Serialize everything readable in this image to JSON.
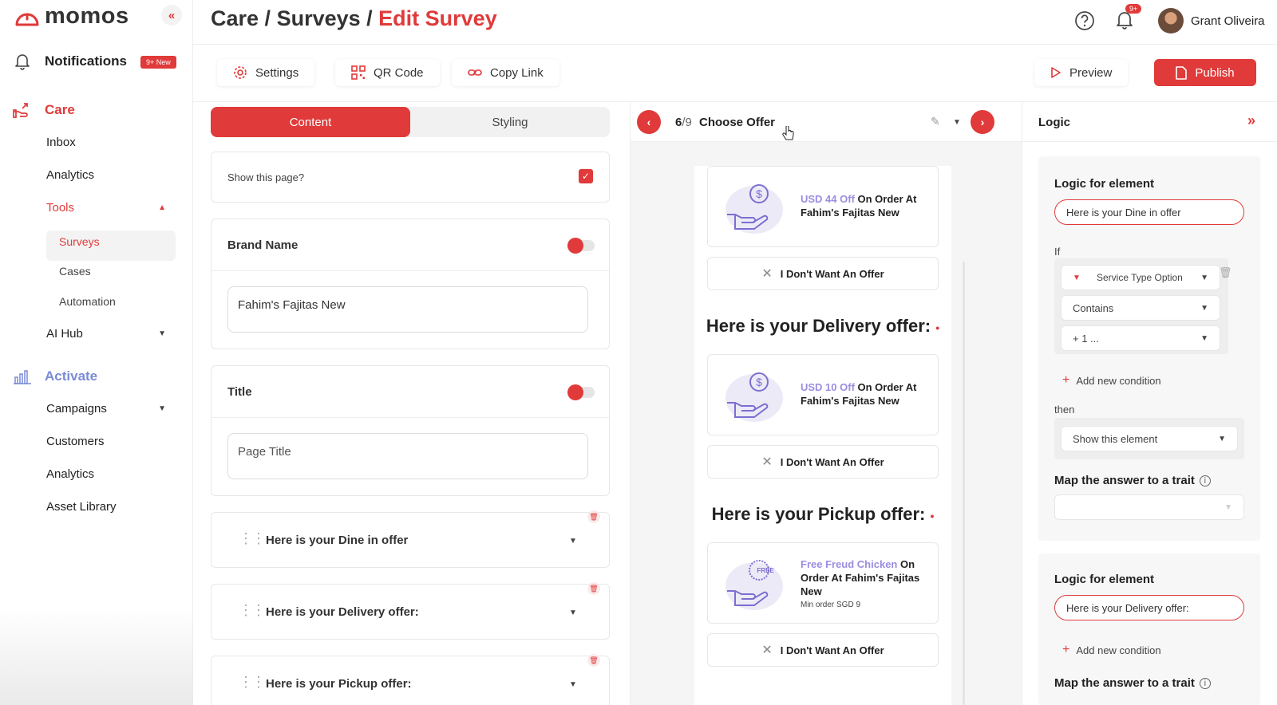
{
  "app": {
    "logo_text": "momos",
    "collapse_label": "«"
  },
  "sidebar": {
    "notifications": {
      "label": "Notifications",
      "badge": "9+ New"
    },
    "care": {
      "label": "Care",
      "items": {
        "inbox": "Inbox",
        "analytics": "Analytics",
        "tools": "Tools",
        "surveys": "Surveys",
        "cases": "Cases",
        "automation": "Automation",
        "ai_hub": "AI Hub"
      }
    },
    "activate": {
      "label": "Activate",
      "items": {
        "campaigns": "Campaigns",
        "customers": "Customers",
        "analytics": "Analytics",
        "asset_library": "Asset Library"
      }
    }
  },
  "header": {
    "breadcrumb": {
      "part1": "Care",
      "sep1": " / ",
      "part2": "Surveys",
      "sep2": " / ",
      "current": "Edit Survey"
    },
    "notif_count": "9+",
    "user_name": "Grant Oliveira"
  },
  "toolbar": {
    "settings": "Settings",
    "qr_code": "QR Code",
    "copy_link": "Copy Link",
    "preview": "Preview",
    "publish": "Publish"
  },
  "content_panel": {
    "tab_content": "Content",
    "tab_styling": "Styling",
    "show_page_label": "Show this page?",
    "brand_name_label": "Brand Name",
    "brand_name_value": "Fahim's Fajitas New",
    "title_label": "Title",
    "title_placeholder": "Page Title",
    "accordions": [
      "Here is your Dine in offer",
      "Here is your Delivery offer:",
      "Here is your Pickup offer:"
    ]
  },
  "preview": {
    "page_current": "6",
    "page_total": "/9",
    "page_name": "Choose Offer",
    "offers": [
      {
        "highlight": "USD 44 Off",
        "text": " On Order At Fahim's Fajitas New",
        "min_order": ""
      },
      {
        "highlight": "USD 10 Off",
        "text": " On Order At Fahim's Fajitas New",
        "min_order": ""
      },
      {
        "highlight": "Free Freud Chicken",
        "text": " On Order At Fahim's Fajitas New",
        "min_order": "Min order SGD 9"
      }
    ],
    "no_offer_label": "I Don't Want An Offer",
    "section_titles": [
      "Here is your Delivery offer:",
      "Here is your Pickup offer:"
    ],
    "free_badge": "FREE"
  },
  "logic_panel": {
    "title": "Logic",
    "blocks": [
      {
        "heading": "Logic for element",
        "element": "Here is your Dine in offer",
        "if_label": "If",
        "condition_field": "Service Type Option",
        "operator": "Contains",
        "value": "+ 1 ...",
        "add_condition": "Add new condition",
        "then_label": "then",
        "action": "Show this element",
        "map_trait_label": "Map the answer to a trait"
      },
      {
        "heading": "Logic for element",
        "element": "Here is your Delivery offer:",
        "add_condition": "Add new condition",
        "map_trait_label": "Map the answer to a trait"
      }
    ]
  },
  "colors": {
    "accent": "#e03a3a",
    "offer_link": "#9a8ee0",
    "activate": "#7b8bd6"
  }
}
